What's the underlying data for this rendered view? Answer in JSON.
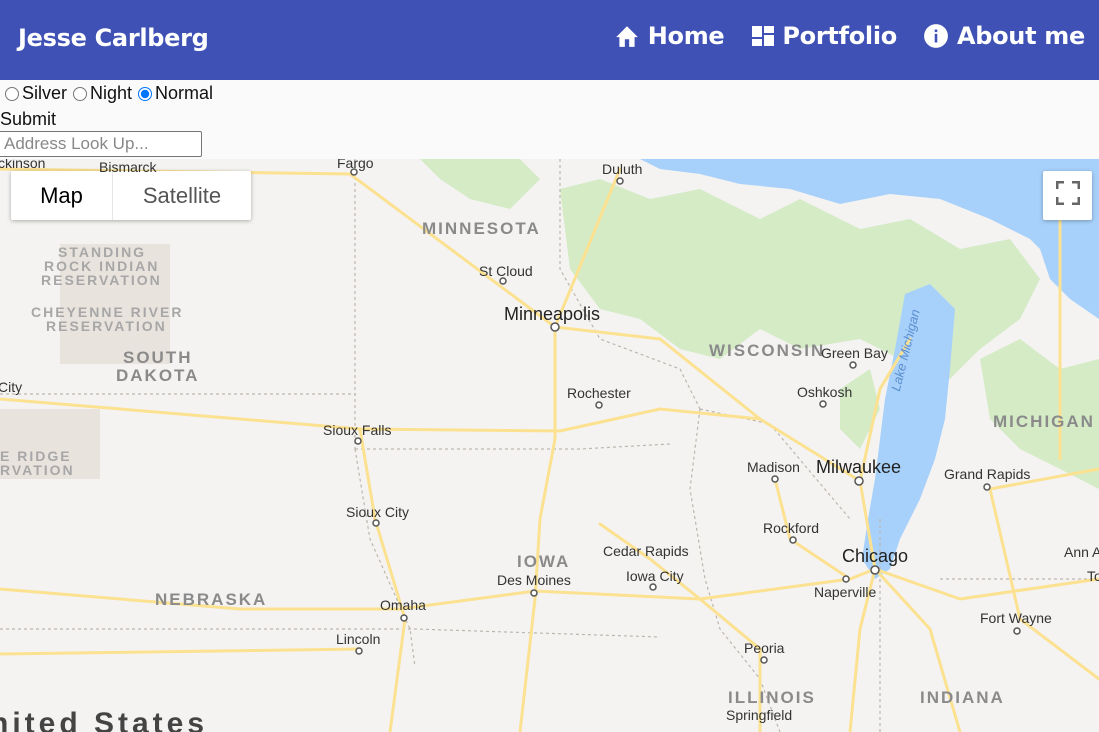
{
  "header": {
    "brand": "Jesse Carlberg",
    "nav": [
      {
        "label": "Home",
        "icon": "home-icon"
      },
      {
        "label": "Portfolio",
        "icon": "dashboard-icon"
      },
      {
        "label": "About me",
        "icon": "info-icon"
      }
    ],
    "colors": {
      "bar": "#3f51b5",
      "text": "#ffffff"
    }
  },
  "controls": {
    "styles": [
      {
        "label": "Silver",
        "checked": false
      },
      {
        "label": "Night",
        "checked": false
      },
      {
        "label": "Normal",
        "checked": true
      }
    ],
    "submit_label": "Submit",
    "address_placeholder": "Address Look Up..."
  },
  "map": {
    "type_buttons": {
      "map": "Map",
      "satellite": "Satellite"
    },
    "fullscreen_icon": "fullscreen-icon",
    "states": {
      "minnesota": "MINNESOTA",
      "wisconsin": "WISCONSIN",
      "south_dakota_1": "SOUTH",
      "south_dakota_2": "DAKOTA",
      "iowa": "IOWA",
      "nebraska": "NEBRASKA",
      "illinois": "ILLINOIS",
      "indiana": "INDIANA",
      "michigan": "MICHIGAN"
    },
    "reservations": {
      "standing_rock_1": "STANDING",
      "standing_rock_2": "ROCK INDIAN",
      "standing_rock_3": "RESERVATION",
      "cheyenne_1": "CHEYENNE RIVER",
      "cheyenne_2": "RESERVATION",
      "pine_ridge_1": "E RIDGE",
      "pine_ridge_2": "RVATION"
    },
    "cities": {
      "bismarck": "Bismarck",
      "fargo": "Fargo",
      "duluth": "Duluth",
      "st_cloud": "St Cloud",
      "minneapolis": "Minneapolis",
      "green_bay": "Green Bay",
      "oshkosh": "Oshkosh",
      "rochester": "Rochester",
      "sioux_falls": "Sioux Falls",
      "madison": "Madison",
      "milwaukee": "Milwaukee",
      "grand_rapids": "Grand Rapids",
      "sioux_city": "Sioux City",
      "rockford": "Rockford",
      "cedar_rapids": "Cedar Rapids",
      "iowa_city": "Iowa City",
      "des_moines": "Des Moines",
      "chicago": "Chicago",
      "naperville": "Naperville",
      "omaha": "Omaha",
      "lincoln": "Lincoln",
      "fort_wayne": "Fort Wayne",
      "peoria": "Peoria",
      "springfield": "Springfield",
      "ann_arbor": "Ann A",
      "toledo": "To",
      "rapid_city": "City",
      "dickinson": "ckinson"
    },
    "lake_michigan": "Lake Michigan",
    "country": "nited States",
    "colors": {
      "land": "#f4f3f1",
      "forest": "#cde8c0",
      "water": "#a7d1fb",
      "highway": "#fbe190",
      "reservation": "#e8e2dc"
    }
  }
}
